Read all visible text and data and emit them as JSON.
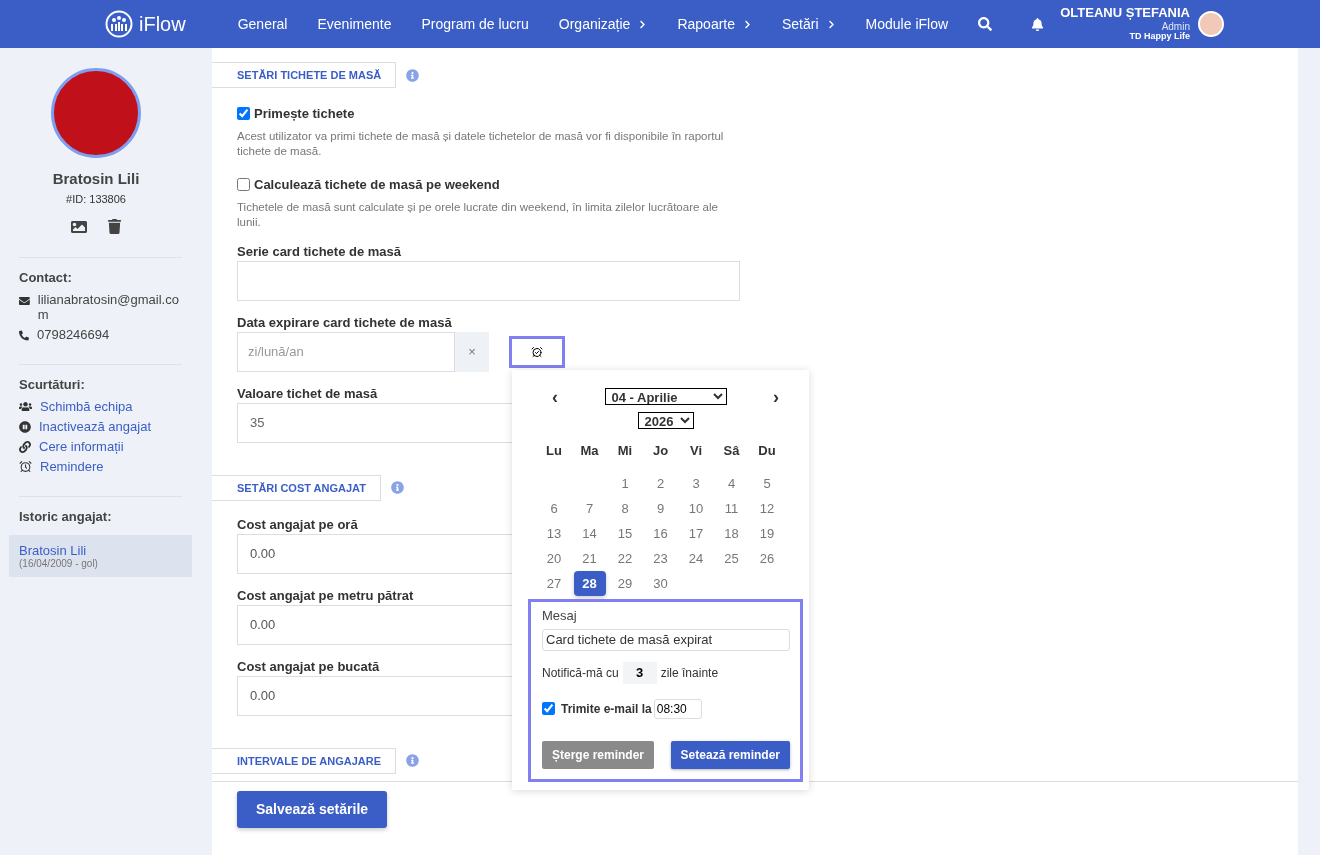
{
  "header": {
    "logo": "iFlow",
    "nav": [
      {
        "label": "General",
        "has_menu": false
      },
      {
        "label": "Evenimente",
        "has_menu": false
      },
      {
        "label": "Program de lucru",
        "has_menu": false
      },
      {
        "label": "Organizație",
        "has_menu": true
      },
      {
        "label": "Rapoarte",
        "has_menu": true
      },
      {
        "label": "Setări",
        "has_menu": true
      },
      {
        "label": "Module iFlow",
        "has_menu": false
      }
    ],
    "user": {
      "name": "OLTEANU ȘTEFANIA",
      "role": "Admin",
      "company": "TD Happy Life"
    }
  },
  "sidebar": {
    "name": "Bratosin Lili",
    "id": "#ID: 133806",
    "contact_title": "Contact:",
    "email": "lilianabratosin@gmail.com",
    "phone": "0798246694",
    "shortcuts_title": "Scurtături:",
    "shortcuts": [
      {
        "kind": "team",
        "label": "Schimbă echipa"
      },
      {
        "kind": "pause",
        "label": "Inactivează angajat"
      },
      {
        "kind": "link",
        "label": "Cere informații"
      },
      {
        "kind": "alarm",
        "label": "Remindere"
      }
    ],
    "history_title": "Istoric angajat:",
    "history": [
      {
        "name": "Bratosin Lili",
        "period": "(16/04/2009 - gol)",
        "selected": true
      }
    ]
  },
  "meal_tickets": {
    "title": "SETĂRI TICHETE DE MASĂ",
    "options": [
      {
        "label": "Primește tichete",
        "checked": true,
        "description": "Acest utilizator va primi tichete de masă și datele tichetelor de masă vor fi disponibile în raportul tichete de masă."
      },
      {
        "label": "Calculează tichete de masă pe weekend",
        "checked": false,
        "description": "Tichetele de masă sunt calculate și pe orele lucrate din weekend, în limita zilelor lucrătoare ale lunii."
      }
    ],
    "card_series": {
      "label": "Serie card tichete de masă"
    },
    "expiry": {
      "label": "Data expirare card tichete de masă",
      "placeholder": "zi/lună/an",
      "clear": "×"
    },
    "ticket_value": {
      "label": "Valoare tichet de masă",
      "value": "35"
    }
  },
  "calendar": {
    "prev": "‹",
    "next": "›",
    "month": "04 - Aprilie",
    "year": "2026",
    "weekdays": [
      "Lu",
      "Ma",
      "Mi",
      "Jo",
      "Vi",
      "Sâ",
      "Du"
    ],
    "weeks": [
      [
        {
          "label": "1",
          "selected": false
        },
        {
          "label": "2",
          "selected": false
        },
        {
          "label": "3",
          "selected": false
        },
        {
          "label": "4",
          "selected": false
        },
        {
          "label": "5",
          "selected": false
        }
      ],
      [
        {
          "label": "6",
          "selected": false
        },
        {
          "label": "7",
          "selected": false
        },
        {
          "label": "8",
          "selected": false
        },
        {
          "label": "9",
          "selected": false
        },
        {
          "label": "10",
          "selected": false
        },
        {
          "label": "11",
          "selected": false
        },
        {
          "label": "12",
          "selected": false
        }
      ],
      [
        {
          "label": "13",
          "selected": false
        },
        {
          "label": "14",
          "selected": false
        },
        {
          "label": "15",
          "selected": false
        },
        {
          "label": "16",
          "selected": false
        },
        {
          "label": "17",
          "selected": false
        },
        {
          "label": "18",
          "selected": false
        },
        {
          "label": "19",
          "selected": false
        }
      ],
      [
        {
          "label": "20",
          "selected": false
        },
        {
          "label": "21",
          "selected": false
        },
        {
          "label": "22",
          "selected": false
        },
        {
          "label": "23",
          "selected": false
        },
        {
          "label": "24",
          "selected": false
        },
        {
          "label": "25",
          "selected": false
        },
        {
          "label": "26",
          "selected": false
        }
      ],
      [
        {
          "label": "27",
          "selected": false
        },
        {
          "label": "28",
          "selected": true
        },
        {
          "label": "29",
          "selected": false
        },
        {
          "label": "30",
          "selected": false
        }
      ]
    ],
    "reminder": {
      "message_label": "Mesaj",
      "message": "Card tichete de masă expirat",
      "notify_before": "Notifică-mă cu",
      "notify_days": "3",
      "notify_after": "zile înainte",
      "email_checked": true,
      "email_label": "Trimite e-mail la",
      "email_time": "08:30",
      "buttons": [
        {
          "label": "Șterge reminder",
          "disabled": true
        },
        {
          "label": "Setează reminder",
          "disabled": false
        }
      ]
    }
  },
  "employee_cost": {
    "title": "SETĂRI COST ANGAJAT",
    "fields": [
      {
        "label": "Cost angajat pe oră",
        "value": "0.00"
      },
      {
        "label": "Cost angajat pe metru pătrat",
        "value": "0.00"
      },
      {
        "label": "Cost angajat pe bucată",
        "value": "0.00"
      }
    ]
  },
  "employment": {
    "title": "INTERVALE DE ANGAJARE"
  },
  "save_button": "Salvează setările"
}
